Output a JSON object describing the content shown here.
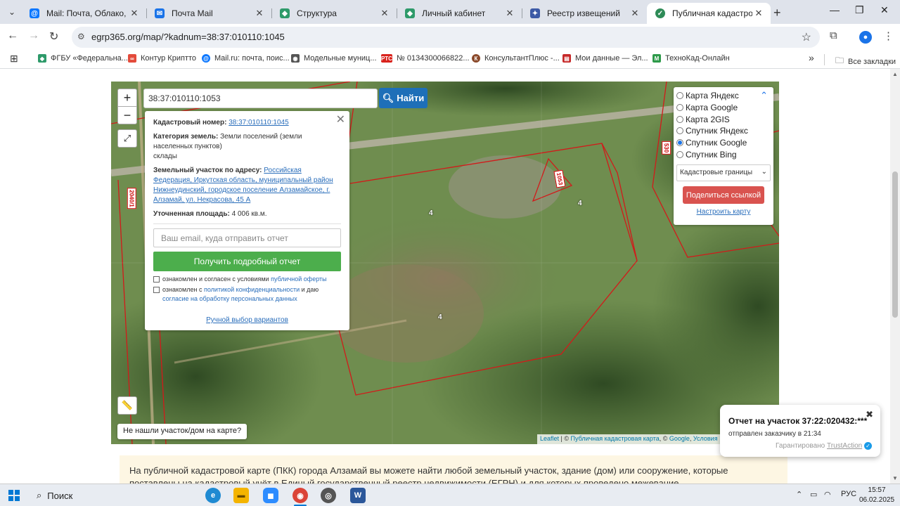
{
  "browser": {
    "tabs": [
      {
        "title": "Mail: Почта, Облако, Кален",
        "icon": "mail-at-icon",
        "color": "#0b77ff",
        "active": false
      },
      {
        "title": "Почта Mail",
        "icon": "mail-icon",
        "color": "#1a73e8",
        "active": false
      },
      {
        "title": "Структура",
        "icon": "rosreestr-icon",
        "color": "#2e9a6a",
        "active": false
      },
      {
        "title": "Личный кабинет",
        "icon": "rosreestr-icon",
        "color": "#2e9a6a",
        "active": false
      },
      {
        "title": "Реестр извещений",
        "icon": "emblem-icon",
        "color": "#3c5aa6",
        "active": false
      },
      {
        "title": "Публичная кадастровая к",
        "icon": "check-circle-icon",
        "color": "#2e8b57",
        "active": true
      }
    ],
    "url": "egrp365.org/map/?kadnum=38:37:010110:1045",
    "bookmarks": [
      {
        "label": "ФГБУ «Федеральна...",
        "color": "#2e9a6a"
      },
      {
        "label": "Контур Криптто",
        "color": "#e34b3b"
      },
      {
        "label": "Mail.ru: почта, поис...",
        "color": "#0b77ff"
      },
      {
        "label": "Модельные муниц...",
        "color": "#555555"
      },
      {
        "label": "№ 0134300066822...",
        "color": "#d9231d"
      },
      {
        "label": "КонсультантПлюс -...",
        "color": "#8b4a2b"
      },
      {
        "label": "Мои данные — Эл...",
        "color": "#c62828"
      },
      {
        "label": "ТехноКад-Онлайн",
        "color": "#2e9a4a"
      }
    ],
    "all_bookmarks": "Все закладки"
  },
  "map": {
    "search_value": "38:37:010110:1053",
    "find_label": "Найти",
    "zoom_in": "+",
    "zoom_out": "−",
    "info": {
      "cad_label": "Кадастровый номер:",
      "cad_value": "38:37:010110:1045",
      "cat_label": "Категория земель:",
      "cat_value": "Земли поселений (земли населенных пунктов)",
      "use_value": "склады",
      "addr_label": "Земельный участок по адресу:",
      "addr_value": "Российская Федерация, Иркутская область, муниципальный район Нижнеудинский, городское поселение Алзамайское, г. Алзамай, ул. Некрасова, 45 А",
      "area_label": "Уточненная площадь:",
      "area_value": "4 006 кв.м.",
      "email_placeholder": "Ваш email, куда отправить отчет",
      "get_report": "Получить подробный отчет",
      "agree1_text": "ознакомлен и согласен с условиями",
      "agree1_link": "публичной оферты",
      "agree2_text": "ознакомлен с",
      "agree2_link": "политикой конфиденциальности",
      "agree2_text2": "и даю",
      "agree2_link2": "согласие на обработку персональных данных",
      "manual": "Ручной выбор вариантов"
    },
    "layers": {
      "options": [
        {
          "label": "Карта Яндекс",
          "selected": false
        },
        {
          "label": "Карта Google",
          "selected": false
        },
        {
          "label": "Карта 2GIS",
          "selected": false
        },
        {
          "label": "Спутник Яндекс",
          "selected": false
        },
        {
          "label": "Спутник Google",
          "selected": true
        },
        {
          "label": "Спутник Bing",
          "selected": false
        }
      ],
      "select_value": "Кадастровые границы",
      "share": "Поделиться ссылкой",
      "configure": "Настроить карту"
    },
    "not_found": "Не нашли участок/дом на карте?",
    "attribution": {
      "leaflet": "Leaflet",
      "sep": " | © ",
      "pkk": "Публичная кадастровая карта",
      "sep2": ", © ",
      "google": "Google",
      "sep3": ", ",
      "terms": "Условия"
    },
    "labels": {
      "plot_1053": "1053",
      "num_a": "4",
      "num_b": "4",
      "num_c": "4",
      "road_left": "2040/1",
      "right_tag": "530"
    }
  },
  "notification": {
    "title": "Отчет на участок 37:22:020432:***",
    "subtitle": "отправлен заказчику в 21:34",
    "guarantee": "Гарантировано",
    "brand": "TrustAction"
  },
  "intro_text": "На публичной кадастровой карте (ПКК) города Алзамай вы можете найти любой земельный участок, здание (дом) или сооружение, которые поставлены на кадастровый учёт в Единый государственный реестр недвижимости (ЕГРН) и для которых проведено межевание.",
  "taskbar": {
    "search": "Поиск",
    "lang": "РУС",
    "time": "15:57",
    "date": "06.02.2025"
  }
}
